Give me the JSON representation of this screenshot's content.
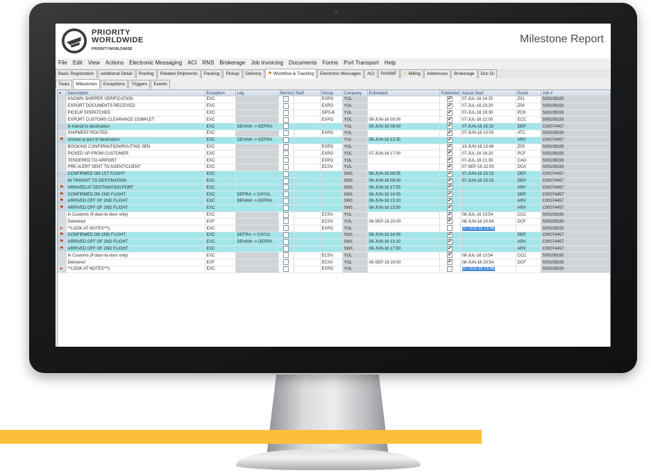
{
  "colors": {
    "accent_bar": "#fbbf3b",
    "row_highlight": "#a3e6ea",
    "header_text": "#2a4d7a"
  },
  "app": {
    "logo_line1": "PRIORITY",
    "logo_line2": "WORLDWIDE",
    "logo_line3": "PRIORITYWORLDWIDE",
    "title": "Milestone Report"
  },
  "menu": [
    "File",
    "Edit",
    "View",
    "Actions",
    "Electronic Messaging",
    "ACI",
    "RNS",
    "Brokerage",
    "Job Invoicing",
    "Documents",
    "Forms",
    "Port Transport",
    "Help"
  ],
  "main_tabs": [
    {
      "label": "Basic Registration",
      "icon": ""
    },
    {
      "label": "Additional Detail",
      "icon": ""
    },
    {
      "label": "Routing",
      "icon": ""
    },
    {
      "label": "Related Shipments",
      "icon": ""
    },
    {
      "label": "Packing",
      "icon": ""
    },
    {
      "label": "Pickup",
      "icon": ""
    },
    {
      "label": "Delivery",
      "icon": ""
    },
    {
      "label": "Workflow & Tracking",
      "icon": "flag-icon",
      "active": true
    },
    {
      "label": "Electronic Messages",
      "icon": ""
    },
    {
      "label": "ACI",
      "icon": ""
    },
    {
      "label": "RHSMF",
      "icon": ""
    },
    {
      "label": "Billing",
      "icon": "warning-icon"
    },
    {
      "label": "Addresses",
      "icon": ""
    },
    {
      "label": "Brokerage",
      "icon": ""
    },
    {
      "label": "Doc Dr",
      "icon": ""
    }
  ],
  "sub_tabs": [
    {
      "label": "Tasks"
    },
    {
      "label": "Milestones",
      "active": true
    },
    {
      "label": "Exceptions"
    },
    {
      "label": "Triggers"
    },
    {
      "label": "Events"
    }
  ],
  "columns": [
    "",
    "Description",
    "Exception",
    "Leg",
    "Reminder",
    "Staff",
    "Group",
    "Company",
    "Estimated",
    "Published",
    "Actual Start",
    "Event",
    "Job #"
  ],
  "rows": [
    {
      "ind": "",
      "hl": false,
      "desc": "KNOWN SHIPPER VERIFICATION",
      "exc": "EXC",
      "leg": "",
      "leg_grey": true,
      "group": "EXPO",
      "company": "YUL",
      "est": "",
      "pub": true,
      "start": "07-JUL-16 14:20",
      "event": "Z01",
      "job": "S00109193"
    },
    {
      "ind": "",
      "hl": false,
      "desc": "EXPORT DOCUMENTS RECEIVED",
      "exc": "EXC",
      "leg": "",
      "leg_grey": true,
      "group": "EXPO",
      "company": "YUL",
      "est": "",
      "pub": true,
      "start": "07-JUL-16 23:20",
      "event": "Z04",
      "job": "S00109193"
    },
    {
      "ind": "",
      "hl": false,
      "desc": "PICKUP DISPATCHED",
      "exc": "EXC",
      "leg": "",
      "leg_grey": true,
      "group": "OPS-B",
      "company": "YUL",
      "est": "",
      "pub": true,
      "start": "07-JUL-16 19:30",
      "event": "PCK",
      "job": "S00109193"
    },
    {
      "ind": "",
      "hl": false,
      "desc": "EXPORT CUSTOMS CLEARANCE COMPLET",
      "exc": "EXC",
      "leg": "",
      "leg_grey": true,
      "group": "EXPO",
      "company": "YUL",
      "est": "08-JUN-16 00:00",
      "pub": true,
      "start": "07-JUL-16 22:00",
      "event": "ECC",
      "job": "S00109193"
    },
    {
      "ind": "",
      "hl": true,
      "desc": "In transit to destination",
      "exc": "EXC",
      "leg": "DEHAM -> DEFRA",
      "leg_grey": false,
      "group": "",
      "company": "YUL",
      "est": "08-JUN-16 08:00",
      "pub": true,
      "start": "07-JUN-16 15:10",
      "event": "DEP",
      "job": "C00074457"
    },
    {
      "ind": "",
      "hl": false,
      "desc": "SHIPMENT ROUTED",
      "exc": "EXC",
      "leg": "",
      "leg_grey": true,
      "group": "EXPO",
      "company": "YUL",
      "est": "",
      "pub": true,
      "start": "07-JUN-16 10:03",
      "event": "ATC",
      "job": "S00109193"
    },
    {
      "ind": "⚑",
      "hl": true,
      "desc": "Arrived at port of destination",
      "exc": "EXC",
      "leg": "DEHAM -> DEFRA",
      "leg_grey": false,
      "group": "",
      "company": "YUL",
      "est": "08-JUN-16 13:30",
      "pub": true,
      "start": "",
      "event": "ARV",
      "job": "C00074457"
    },
    {
      "ind": "",
      "hl": false,
      "desc": "BOOKING CONFIRMATION/ROUTING SEN",
      "exc": "EXC",
      "leg": "",
      "leg_grey": true,
      "group": "EXPO",
      "company": "YUL",
      "est": "",
      "pub": true,
      "start": "13-JUN-16 13:48",
      "event": "Z05",
      "job": "S00109193"
    },
    {
      "ind": "",
      "hl": false,
      "desc": "PICKED UP FROM CUSTOMER",
      "exc": "EXC",
      "leg": "",
      "leg_grey": true,
      "group": "EXPO",
      "company": "YUL",
      "est": "07-JUN-16 17:00",
      "pub": true,
      "start": "07-JUL-16 18:20",
      "event": "PCF",
      "job": "S00109193"
    },
    {
      "ind": "",
      "hl": false,
      "desc": "TENDERED TO AIRPORT",
      "exc": "EXC",
      "leg": "",
      "leg_grey": true,
      "group": "EXPO",
      "company": "YUL",
      "est": "",
      "pub": true,
      "start": "07-JUL-16 21:30",
      "event": "CAG",
      "job": "S00109193"
    },
    {
      "ind": "",
      "hl": false,
      "desc": "PRE ALERT SENT TO AGENT/CLIENT",
      "exc": "EXC",
      "leg": "",
      "leg_grey": true,
      "group": "ECSV",
      "company": "YUL",
      "est": "",
      "pub": true,
      "start": "07-SEP-16 22:03",
      "event": "DCA",
      "job": "S00109193"
    },
    {
      "ind": "",
      "hl": true,
      "desc": "CONFIRMED ON 1ST FLIGHT",
      "exc": "EXC",
      "leg": "",
      "leg_grey": false,
      "group": "",
      "company": "SW1",
      "est": "06-JUN-16 08:05",
      "pub": true,
      "start": "07-JUN-16 15:13",
      "event": "DEP",
      "job": "C00074457"
    },
    {
      "ind": "",
      "hl": true,
      "desc": "IN TRANSIT TO DESTINATION",
      "exc": "EXC",
      "leg": "",
      "leg_grey": false,
      "group": "",
      "company": "SW1",
      "est": "08-JUN-16 08:00",
      "pub": true,
      "start": "07-JUN-16 15:13",
      "event": "DEP",
      "job": "C00074457"
    },
    {
      "ind": "⚑",
      "hl": true,
      "desc": "ARRIVED AT DESTINATION PORT",
      "exc": "EXC",
      "leg": "",
      "leg_grey": false,
      "group": "",
      "company": "SW1",
      "est": "08-JUN-16 17:50",
      "pub": true,
      "start": "",
      "event": "ARV",
      "job": "C00074457"
    },
    {
      "ind": "⚑",
      "hl": true,
      "desc": "CONFIRMED ON 2ND FLIGHT",
      "exc": "EXC",
      "leg": "DEFRA -> CAYUL",
      "leg_grey": false,
      "group": "",
      "company": "SW1",
      "est": "08-JUN-16 14:00",
      "pub": true,
      "start": "",
      "event": "DEP",
      "job": "C00074457"
    },
    {
      "ind": "⚑",
      "hl": true,
      "desc": "ARRIVED OFF OF 2ND FLIGHT",
      "exc": "EXC",
      "leg": "DEHAM -> DEFRA",
      "leg_grey": false,
      "group": "",
      "company": "SW1",
      "est": "08-JUN-16 13:10",
      "pub": true,
      "start": "",
      "event": "ARV",
      "job": "C00074457"
    },
    {
      "ind": "⚑",
      "hl": true,
      "desc": "ARRIVED OFF OF 2ND FLIGHT",
      "exc": "EXC",
      "leg": "",
      "leg_grey": false,
      "group": "",
      "company": "SW1",
      "est": "08-JUN-16 13:50",
      "pub": true,
      "start": "",
      "event": "ARV",
      "job": "C00074457"
    },
    {
      "ind": "",
      "hl": false,
      "desc": "In Customs (If door-to-door only)",
      "exc": "EXC",
      "leg": "",
      "leg_grey": true,
      "group": "ECSV",
      "company": "YUL",
      "est": "",
      "pub": true,
      "start": "08-JUL-16 13:54",
      "event": "CCC",
      "job": "S00109193"
    },
    {
      "ind": "",
      "hl": false,
      "desc": "Delivered",
      "exc": "EXF",
      "leg": "",
      "leg_grey": true,
      "group": "ECSV",
      "company": "YUL",
      "est": "08-SEP-16 20:00",
      "pub": true,
      "start": "08-JUN-16 20:54",
      "event": "DCF",
      "job": "S00109193"
    },
    {
      "ind": "▸",
      "hl": false,
      "desc": "**LOOK AT NOTES**!)",
      "exc": "EXC",
      "leg": "",
      "leg_grey": true,
      "group": "EXPO",
      "company": "YUL",
      "est": "",
      "pub": false,
      "start": "07-JUN-16 13:46",
      "start_sel": true,
      "event": "",
      "job": "S00109193"
    },
    {
      "ind": "⚑",
      "hl": true,
      "desc": "CONFIRMED ON 2ND FLIGHT",
      "exc": "EXC",
      "leg": "DEFRA -> CAYUL",
      "leg_grey": false,
      "group": "",
      "company": "SW1",
      "est": "08-JUN-16 14:00",
      "pub": true,
      "start": "",
      "event": "DEP",
      "job": "C00074457"
    },
    {
      "ind": "⚑",
      "hl": true,
      "desc": "ARRIVED OFF OF 2ND FLIGHT",
      "exc": "EXC",
      "leg": "DEHAM -> DEFRA",
      "leg_grey": false,
      "group": "",
      "company": "SW1",
      "est": "08-JUN-16 13:10",
      "pub": true,
      "start": "",
      "event": "ARV",
      "job": "C00074457"
    },
    {
      "ind": "⚑",
      "hl": true,
      "desc": "ARRIVED OFF OF 2ND FLIGHT",
      "exc": "EXC",
      "leg": "",
      "leg_grey": false,
      "group": "",
      "company": "SW1",
      "est": "08-JUN-16 17:50",
      "pub": true,
      "start": "",
      "event": "ARV",
      "job": "C00074457"
    },
    {
      "ind": "",
      "hl": false,
      "desc": "In Customs (If door-to-door only)",
      "exc": "EXC",
      "leg": "",
      "leg_grey": true,
      "group": "ECSV",
      "company": "YUL",
      "est": "",
      "pub": true,
      "start": "08-JUL-16 13:54",
      "event": "CCC",
      "job": "S00109193"
    },
    {
      "ind": "",
      "hl": false,
      "desc": "Delivered",
      "exc": "EXF",
      "leg": "",
      "leg_grey": true,
      "group": "ECSV",
      "company": "YUL",
      "est": "08-SEP-16 20:00",
      "pub": true,
      "start": "08-JUN-16 20:54",
      "event": "DCF",
      "job": "S00109193"
    },
    {
      "ind": "▸",
      "hl": false,
      "desc": "**LOOK AT NOTES**!)",
      "exc": "EXC",
      "leg": "",
      "leg_grey": true,
      "group": "EXPO",
      "company": "YUL",
      "est": "",
      "pub": false,
      "start": "07-JUN-16 13:46",
      "start_sel": true,
      "event": "",
      "job": "S00109193"
    }
  ]
}
